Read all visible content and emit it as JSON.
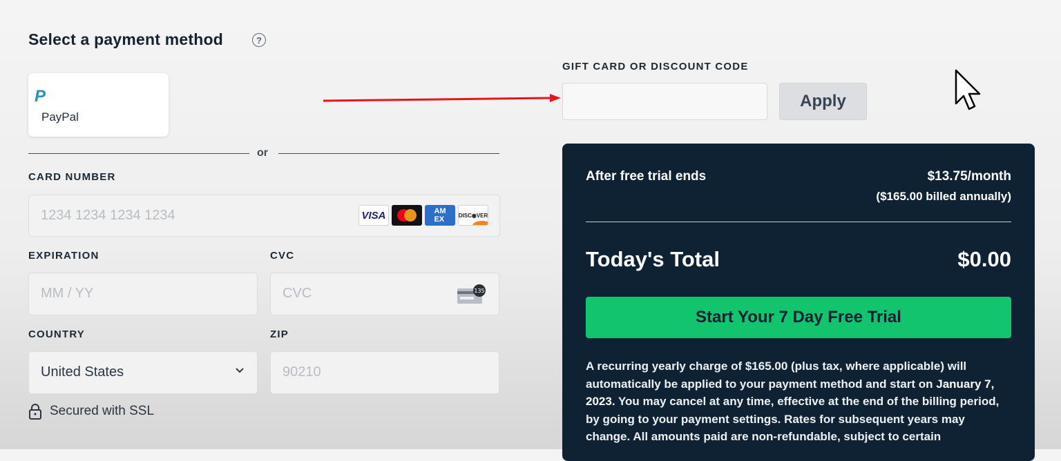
{
  "left": {
    "title": "Select a payment method",
    "paypal": {
      "label": "PayPal",
      "logo_letter": "P"
    },
    "divider_text": "or",
    "card_number": {
      "label": "CARD NUMBER",
      "placeholder": "1234 1234 1234 1234"
    },
    "card_brands": [
      "VISA",
      "Mastercard",
      "AMEX",
      "DISCOVER"
    ],
    "expiration": {
      "label": "EXPIRATION",
      "placeholder": "MM / YY"
    },
    "cvc": {
      "label": "CVC",
      "placeholder": "CVC",
      "card_icon_text": "135"
    },
    "country": {
      "label": "COUNTRY",
      "value": "United States"
    },
    "zip": {
      "label": "ZIP",
      "placeholder": "90210"
    },
    "ssl_text": "Secured with SSL"
  },
  "right": {
    "gift_label": "GIFT CARD OR DISCOUNT CODE",
    "gift_input_value": "",
    "apply_label": "Apply",
    "summary": {
      "after_trial_label": "After free trial ends",
      "monthly_price": "$13.75/month",
      "billed_note": "($165.00 billed annually)",
      "total_label": "Today's Total",
      "total_value": "$0.00",
      "cta_label": "Start Your 7 Day Free Trial",
      "legal_part1": "A recurring yearly charge of $165.00 (plus tax, where applicable) will automatically be applied to your payment method and start on ",
      "legal_date": "January 7, 2023",
      "legal_part2": ". You may cancel at any time, effective at the end of the billing period, by going to your payment settings. Rates for subsequent years may change. All amounts paid are non-refundable, subject to certain"
    }
  },
  "colors": {
    "summary_bg": "#0e2234",
    "cta_green": "#12c46d",
    "annotation_arrow": "#e8141c"
  }
}
